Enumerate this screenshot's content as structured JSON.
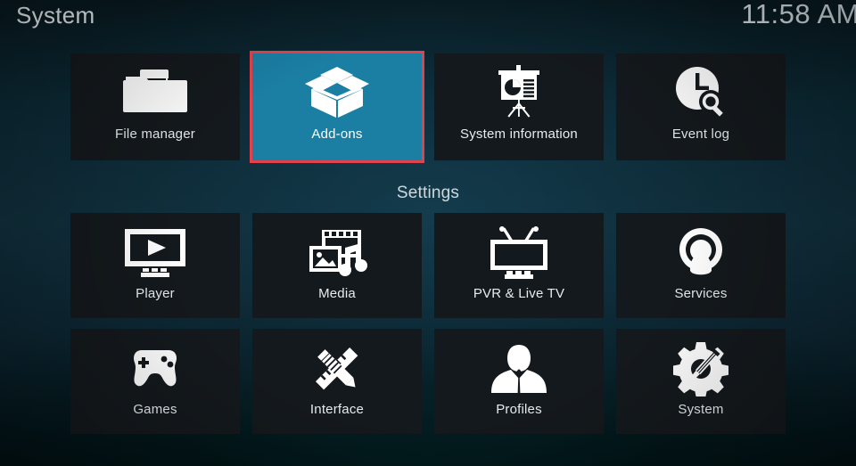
{
  "header": {
    "title": "System",
    "clock": "11:58 AM"
  },
  "colors": {
    "tile_bg": "#14191d",
    "tile_selected_bg": "#1b7ea3",
    "selection_border": "#e0434d",
    "text": "#e6ecef",
    "background_top": "#08191f",
    "background_mid": "#11303d",
    "background_bottom": "#020d11"
  },
  "top_row": {
    "items": [
      {
        "label": "File manager",
        "icon": "folder-icon",
        "selected": false
      },
      {
        "label": "Add-ons",
        "icon": "open-box-icon",
        "selected": true
      },
      {
        "label": "System information",
        "icon": "presentation-board-icon",
        "selected": false
      },
      {
        "label": "Event log",
        "icon": "clock-search-icon",
        "selected": false
      }
    ]
  },
  "settings_section": {
    "label": "Settings",
    "middle_row": {
      "items": [
        {
          "label": "Player",
          "icon": "monitor-play-icon",
          "selected": false
        },
        {
          "label": "Media",
          "icon": "media-collage-icon",
          "selected": false
        },
        {
          "label": "PVR & Live TV",
          "icon": "tv-antenna-icon",
          "selected": false
        },
        {
          "label": "Services",
          "icon": "broadcast-person-icon",
          "selected": false
        }
      ]
    },
    "bottom_row": {
      "items": [
        {
          "label": "Games",
          "icon": "gamepad-icon",
          "selected": false
        },
        {
          "label": "Interface",
          "icon": "pencil-ruler-icon",
          "selected": false
        },
        {
          "label": "Profiles",
          "icon": "person-bust-icon",
          "selected": false
        },
        {
          "label": "System",
          "icon": "gear-screwdriver-icon",
          "selected": false
        }
      ]
    }
  }
}
